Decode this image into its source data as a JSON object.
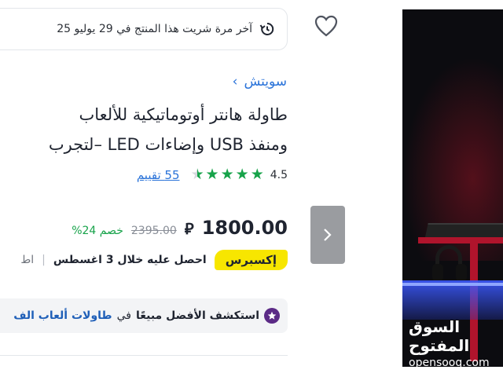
{
  "purchase_history": {
    "text": "آخر مرة شريت هذا المنتج في 29 يوليو 25"
  },
  "breadcrumb": {
    "label": "سويتش",
    "chevron": "›"
  },
  "product": {
    "title_line1": "طاولة هانتر أوتوماتيكية للألعاب",
    "title_line2": "ومنفذ USB وإضاءات LED –لتجرب"
  },
  "rating": {
    "value": "4.5",
    "stars": 4.5,
    "reviews_label": "55 تقييم"
  },
  "price": {
    "current": "1800.00",
    "currency_symbol": "⃁",
    "old": "2395.00",
    "discount": "خصم 24%"
  },
  "delivery": {
    "badge": "إكسبرس",
    "text": "احصل عليه خلال 3 اغسطس",
    "separator": "|",
    "cut_text": "اط"
  },
  "bestseller": {
    "strong": "استكشف الأفضل مبيعًا",
    "in": "في",
    "category": "طاولات ألعاب الف"
  },
  "gallery": {
    "next_chevron": "›",
    "watermark_ar": "السوق المفتوح",
    "watermark_en": "opensooq.com"
  },
  "colors": {
    "link": "#2a73d9",
    "rating_green": "#17a34a",
    "express_yellow": "#f7e600"
  },
  "icons": {
    "history": "history-icon",
    "heart": "heart-icon",
    "star": "star-icon",
    "bestseller": "star-badge-icon"
  }
}
